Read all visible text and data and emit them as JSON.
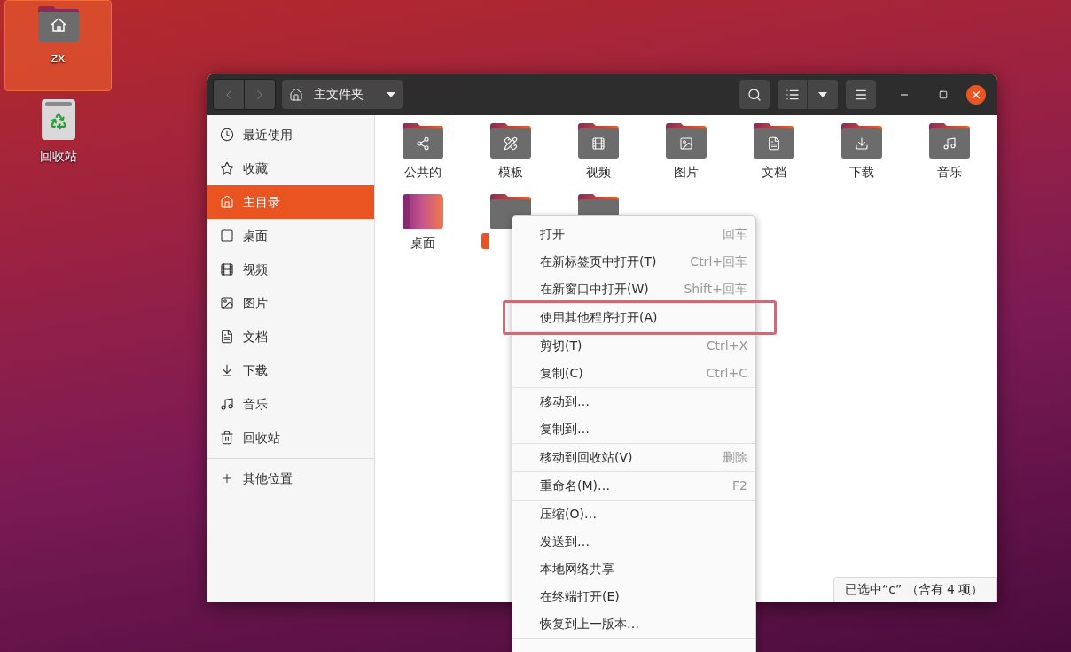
{
  "desktop": {
    "icons": [
      {
        "kind": "home",
        "label": "zx",
        "selected": true
      },
      {
        "kind": "trash",
        "label": "回收站",
        "selected": false
      }
    ]
  },
  "window": {
    "path": "主文件夹",
    "sidebar": {
      "items": [
        {
          "kind": "recent",
          "label": "最近使用",
          "selected": false
        },
        {
          "kind": "starred",
          "label": "收藏",
          "selected": false
        },
        {
          "kind": "home",
          "label": "主目录",
          "selected": true
        },
        {
          "kind": "desktop",
          "label": "桌面",
          "selected": false
        },
        {
          "kind": "video",
          "label": "视频",
          "selected": false
        },
        {
          "kind": "picture",
          "label": "图片",
          "selected": false
        },
        {
          "kind": "document",
          "label": "文档",
          "selected": false
        },
        {
          "kind": "download",
          "label": "下载",
          "selected": false
        },
        {
          "kind": "music",
          "label": "音乐",
          "selected": false
        },
        {
          "kind": "trash",
          "label": "回收站",
          "selected": false
        }
      ],
      "other": {
        "label": "其他位置"
      }
    },
    "items": [
      {
        "kind": "share",
        "label": "公共的",
        "selected": false
      },
      {
        "kind": "template",
        "label": "模板",
        "selected": false
      },
      {
        "kind": "video",
        "label": "视频",
        "selected": false
      },
      {
        "kind": "picture",
        "label": "图片",
        "selected": false
      },
      {
        "kind": "document",
        "label": "文档",
        "selected": false
      },
      {
        "kind": "download",
        "label": "下载",
        "selected": false
      },
      {
        "kind": "music",
        "label": "音乐",
        "selected": false
      },
      {
        "kind": "desktop",
        "label": "桌面",
        "selected": false
      },
      {
        "kind": "plain",
        "selected": true
      },
      {
        "kind": "plain",
        "selected": false
      }
    ],
    "status": "已选中“c” （含有 4 项）"
  },
  "context_menu": {
    "groups": [
      [
        {
          "label": "打开",
          "shortcut": "回车",
          "annotated": false
        },
        {
          "label": "在新标签页中打开(T)",
          "shortcut": "Ctrl+回车",
          "annotated": false
        },
        {
          "label": "在新窗口中打开(W)",
          "shortcut": "Shift+回车",
          "annotated": false
        }
      ],
      [
        {
          "label": "使用其他程序打开(A)",
          "annotated": true
        }
      ],
      [
        {
          "label": "剪切(T)",
          "shortcut": "Ctrl+X",
          "annotated": false
        },
        {
          "label": "复制(C)",
          "shortcut": "Ctrl+C",
          "annotated": false
        }
      ],
      [
        {
          "label": "移动到…",
          "annotated": false
        },
        {
          "label": "复制到…",
          "annotated": false
        }
      ],
      [
        {
          "label": "移动到回收站(V)",
          "shortcut": "删除",
          "annotated": false
        }
      ],
      [
        {
          "label": "重命名(M)…",
          "shortcut": "F2",
          "annotated": false
        }
      ],
      [
        {
          "label": "压缩(O)…",
          "annotated": false
        },
        {
          "label": "发送到…",
          "annotated": false
        },
        {
          "label": "本地网络共享",
          "annotated": false
        },
        {
          "label": "在终端打开(E)",
          "annotated": false
        },
        {
          "label": "恢复到上一版本…",
          "annotated": false
        }
      ]
    ]
  }
}
